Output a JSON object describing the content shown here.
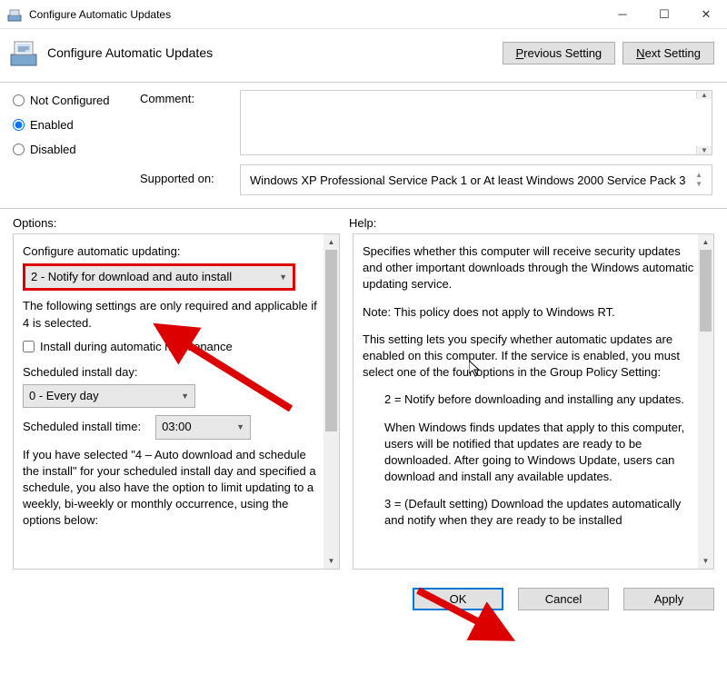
{
  "window": {
    "title": "Configure Automatic Updates",
    "heading": "Configure Automatic Updates"
  },
  "nav": {
    "previous": "Previous Setting",
    "next": "Next Setting"
  },
  "radios": {
    "not_configured": "Not Configured",
    "enabled": "Enabled",
    "disabled": "Disabled",
    "selected": "enabled"
  },
  "labels": {
    "comment": "Comment:",
    "supported": "Supported on:",
    "options": "Options:",
    "help": "Help:"
  },
  "fields": {
    "comment": "",
    "supported": "Windows XP Professional Service Pack 1 or At least Windows 2000 Service Pack 3"
  },
  "options": {
    "heading": "Configure automatic updating:",
    "updating_value": "2 - Notify for download and auto install",
    "note": "The following settings are only required and applicable if 4 is selected.",
    "maintenance": "Install during automatic maintenance",
    "day_label": "Scheduled install day:",
    "day_value": "0 - Every day",
    "time_label": "Scheduled install time:",
    "time_value": "03:00",
    "long_note": "If you have selected \"4 – Auto download and schedule the install\" for your scheduled install day and specified a schedule, you also have the option to limit updating to a weekly, bi-weekly or monthly occurrence, using the options below:"
  },
  "help": {
    "p1": "Specifies whether this computer will receive security updates and other important downloads through the Windows automatic updating service.",
    "p2": "Note: This policy does not apply to Windows RT.",
    "p3": "This setting lets you specify whether automatic updates are enabled on this computer. If the service is enabled, you must select one of the four options in the Group Policy Setting:",
    "p4": "2 = Notify before downloading and installing any updates.",
    "p5": "When Windows finds updates that apply to this computer, users will be notified that updates are ready to be downloaded. After going to Windows Update, users can download and install any available updates.",
    "p6": "3 = (Default setting) Download the updates automatically and notify when they are ready to be installed"
  },
  "footer": {
    "ok": "OK",
    "cancel": "Cancel",
    "apply": "Apply"
  }
}
